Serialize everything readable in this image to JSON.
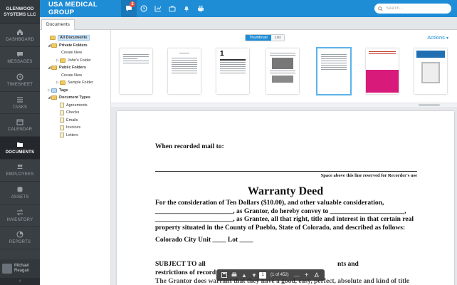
{
  "brand": "GLENWOOD SYSTEMS LLC",
  "app_title": "USA MEDICAL GROUP",
  "notifications_count": "2",
  "search": {
    "placeholder": "Search..."
  },
  "nav": [
    {
      "label": "DASHBOARD",
      "icon": "home-icon"
    },
    {
      "label": "MESSAGES",
      "icon": "chat-icon"
    },
    {
      "label": "TIMESHEET",
      "icon": "clock-icon"
    },
    {
      "label": "TASKS",
      "icon": "list-icon"
    },
    {
      "label": "CALENDAR",
      "icon": "calendar-icon"
    },
    {
      "label": "DOCUMENTS",
      "icon": "folder-icon",
      "active": true
    },
    {
      "label": "EMPLOYEES",
      "icon": "people-icon"
    },
    {
      "label": "ASSETS",
      "icon": "database-icon"
    },
    {
      "label": "INVENTORY",
      "icon": "swap-icon"
    },
    {
      "label": "REPORTS",
      "icon": "chart-icon"
    }
  ],
  "user": {
    "first": "Michael",
    "last": "Reagan"
  },
  "tab": "Documents",
  "tree": {
    "all_documents": "All Documents",
    "private_folders": "Private Folders",
    "create_new_1": "Create New",
    "johns_folder": "John's Folder",
    "public_folders": "Public Folders",
    "create_new_2": "Create New",
    "sample_folder": "Sample Folder",
    "tags": "Tags",
    "document_types": "Document Types",
    "types": [
      "Agreements",
      "Checks",
      "Emails",
      "Invoices",
      "Letters"
    ]
  },
  "view_toggle": {
    "thumbnail": "Thumbnail",
    "list": "List"
  },
  "actions": "Actions",
  "document": {
    "recorded": "When recorded mail to:",
    "space_line": "Space above this line reserved for Recorder's use",
    "title": "Warranty Deed",
    "line1": "For the consideration of Ten Dollars ($10.00), and other valuable consideration,",
    "line2": "_______________________, as Grantor, do hereby convey to ______________________,",
    "line3": "_______________________, as Grantee, all that right, title and interest in that certain real",
    "line4": "property situated in the County of Pueblo, State of Colorado, and described as follows:",
    "city": "Colorado City Unit ____ Lot ____",
    "subject1": "SUBJECT TO all",
    "subject2": "restrictions of record",
    "subject_right": "nts and",
    "grantor": "The Grantor does warrant that they have a good, easy, perfect, absolute and kind of title"
  },
  "pdf_toolbar": {
    "page": "1",
    "of": "(1 of 452)"
  }
}
